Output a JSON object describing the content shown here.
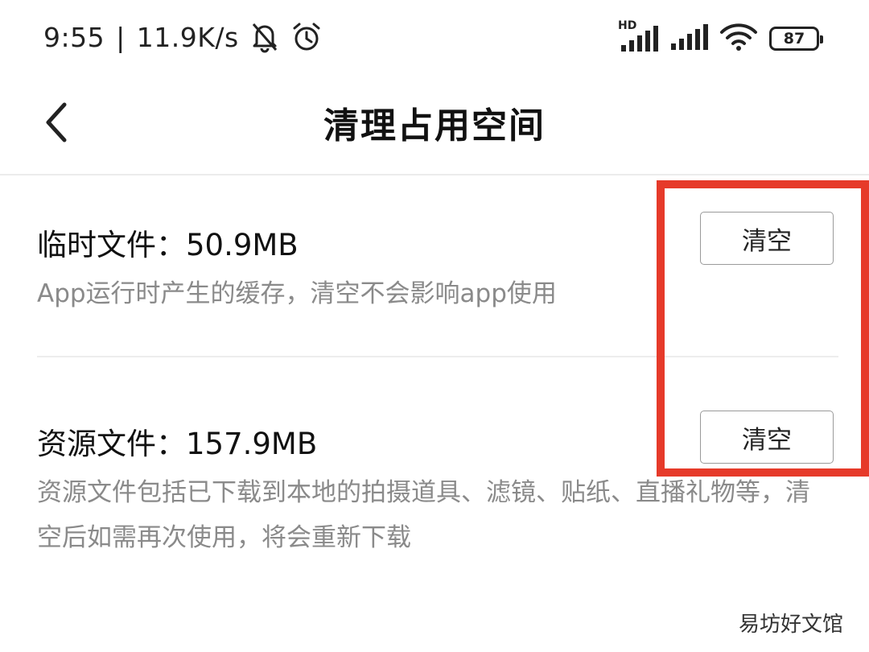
{
  "status_bar": {
    "time": "9:55",
    "separator": "|",
    "net_speed": "11.9K/s",
    "icons": [
      "bell-off-icon",
      "alarm-clock-icon",
      "signal-hd-icon",
      "signal-icon",
      "wifi-icon",
      "battery-icon"
    ],
    "signal_label": "HD",
    "battery_level": "87"
  },
  "nav": {
    "back_icon": "chevron-left-icon",
    "title": "清理占用空间"
  },
  "sections": [
    {
      "title": "临时文件：50.9MB",
      "description": "App运行时产生的缓存，清空不会影响app使用",
      "button_label": "清空"
    },
    {
      "title": "资源文件：157.9MB",
      "description": "资源文件包括已下载到本地的拍摄道具、滤镜、贴纸、直播礼物等，清空后如需再次使用，将会重新下载",
      "button_label": "清空"
    }
  ],
  "annotation": {
    "highlight_color": "#e63a2a"
  },
  "watermark": "易坊好文馆"
}
